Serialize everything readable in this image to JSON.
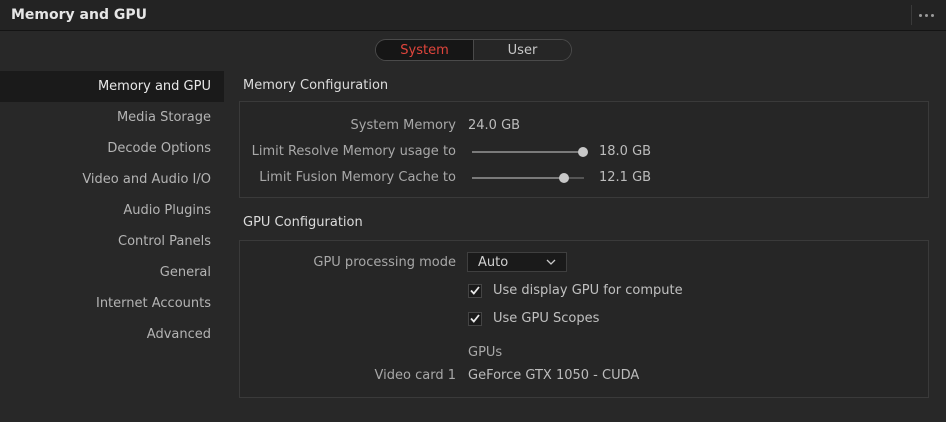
{
  "window": {
    "title": "Memory and GPU"
  },
  "scope_toggle": {
    "system": "System",
    "user": "User",
    "selected": "System",
    "accent": "#e0453c"
  },
  "sidebar": {
    "items": [
      {
        "label": "Memory and GPU",
        "selected": true
      },
      {
        "label": "Media Storage"
      },
      {
        "label": "Decode Options"
      },
      {
        "label": "Video and Audio I/O"
      },
      {
        "label": "Audio Plugins"
      },
      {
        "label": "Control Panels"
      },
      {
        "label": "General"
      },
      {
        "label": "Internet Accounts"
      },
      {
        "label": "Advanced"
      }
    ]
  },
  "memory": {
    "title": "Memory Configuration",
    "system_memory_label": "System Memory",
    "system_memory_value": "24.0 GB",
    "resolve_label": "Limit Resolve Memory usage to",
    "resolve_value": "18.0 GB",
    "resolve_fraction": 0.99,
    "fusion_label": "Limit Fusion Memory Cache to",
    "fusion_value": "12.1 GB",
    "fusion_fraction": 0.82
  },
  "gpu": {
    "title": "GPU Configuration",
    "mode_label": "GPU processing mode",
    "mode_value": "Auto",
    "display_gpu_label": "Use display GPU for compute",
    "display_gpu_checked": true,
    "scopes_label": "Use GPU Scopes",
    "scopes_checked": true,
    "gpus_header": "GPUs",
    "card_label": "Video card 1",
    "card_value": "GeForce GTX 1050 - CUDA"
  }
}
